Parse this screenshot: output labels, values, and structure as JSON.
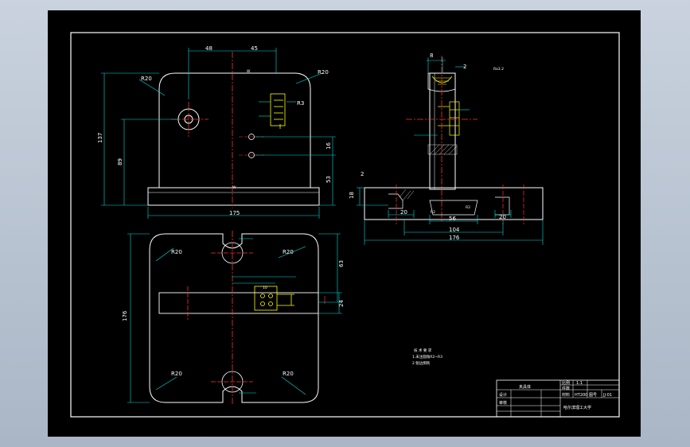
{
  "drawing": {
    "front_view": {
      "dim_top_left": "48",
      "dim_top_right": "45",
      "dim_height_total": "137",
      "dim_height_hole": "89",
      "dim_width": "175",
      "dim_right_16": "16",
      "dim_right_53": "53",
      "radius_left": "R20",
      "radius_right": "R20",
      "radius_small": "R3",
      "mark_v": "W"
    },
    "side_view": {
      "dim_top_8": "8",
      "dim_top_2": "2",
      "dim_left_2": "2",
      "dim_left_18": "18",
      "dim_20_left": "20",
      "dim_20_right": "20",
      "dim_56": "56",
      "dim_104": "104",
      "dim_176": "176",
      "radius_r2_a": "R2",
      "radius_r2_b": "R2",
      "note_top": "Ra3.2"
    },
    "top_view": {
      "radius_tl": "R20",
      "radius_tr": "R20",
      "radius_bl": "R20",
      "radius_br": "R20",
      "dim_height_176": "176",
      "dim_63": "63",
      "dim_24": "24",
      "dim_10": "10"
    },
    "notes": {
      "line1": "技 术 要 求",
      "line2": "1.未注圆角R2~R3",
      "line3": "2.锐边倒钝"
    },
    "title_block": {
      "name": "夹具体",
      "scale_label": "比例",
      "scale_value": "1:1",
      "qty_label": "件数",
      "material_label": "材料",
      "material_value": "HT200",
      "design_label": "设计",
      "check_label": "审核",
      "drawing_no_label": "图号",
      "drawing_no": "JJ-01",
      "school": "哈尔滨理工大学"
    }
  }
}
